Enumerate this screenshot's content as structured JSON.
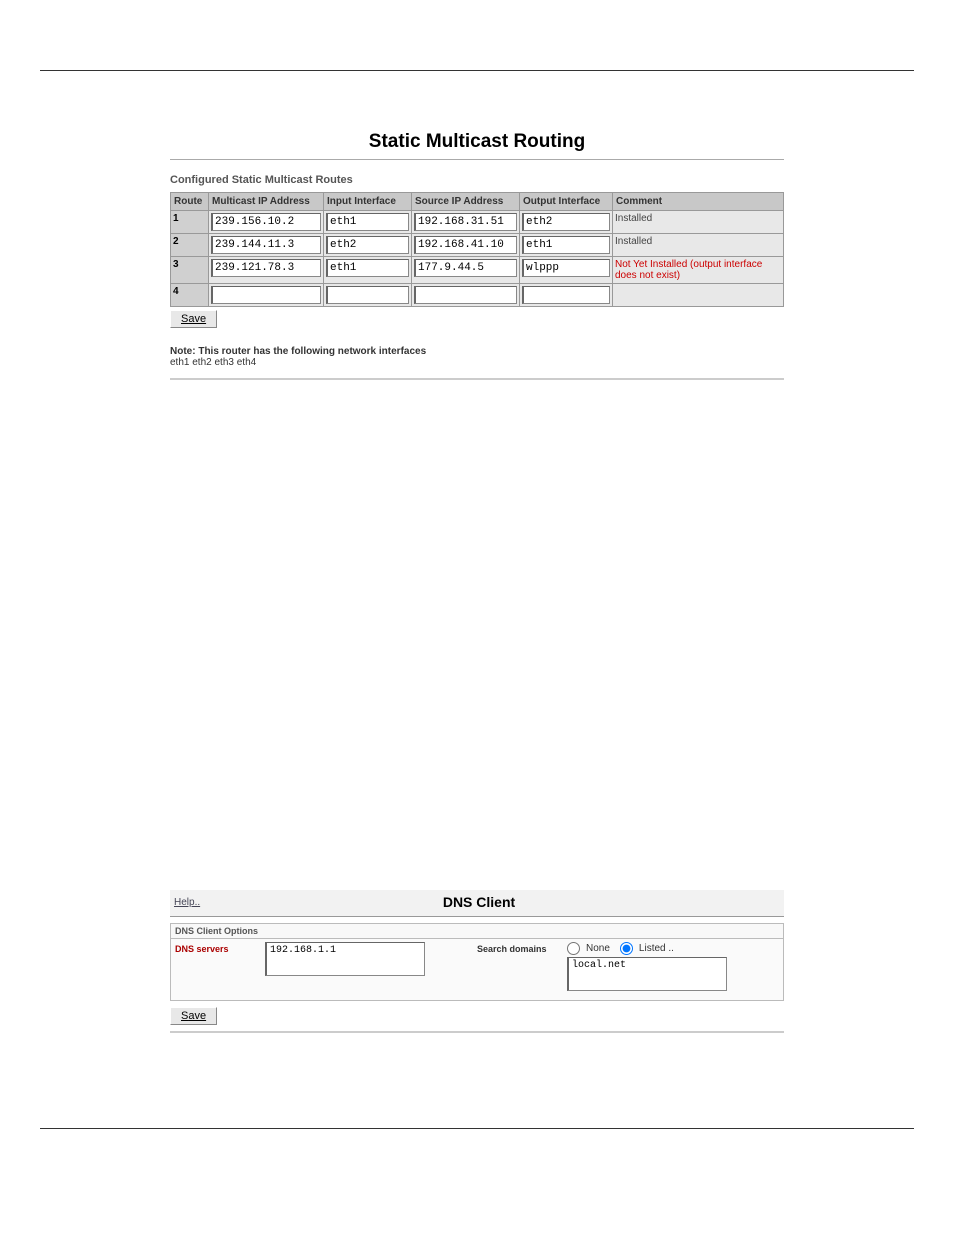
{
  "page1": {
    "title": "Static Multicast Routing",
    "section_label": "Configured Static Multicast Routes",
    "columns": {
      "route": "Route",
      "multicast_ip": "Multicast IP Address",
      "input_if": "Input Interface",
      "source_ip": "Source IP Address",
      "output_if": "Output Interface",
      "comment": "Comment"
    },
    "rows": [
      {
        "num": "1",
        "multicast_ip": "239.156.10.2",
        "input_if": "eth1",
        "source_ip": "192.168.31.51",
        "output_if": "eth2",
        "comment": "Installed",
        "error": false
      },
      {
        "num": "2",
        "multicast_ip": "239.144.11.3",
        "input_if": "eth2",
        "source_ip": "192.168.41.10",
        "output_if": "eth1",
        "comment": "Installed",
        "error": false
      },
      {
        "num": "3",
        "multicast_ip": "239.121.78.3",
        "input_if": "eth1",
        "source_ip": "177.9.44.5",
        "output_if": "wlppp",
        "comment": "Not Yet Installed (output interface does not exist)",
        "error": true
      },
      {
        "num": "4",
        "multicast_ip": "",
        "input_if": "",
        "source_ip": "",
        "output_if": "",
        "comment": "",
        "error": false
      }
    ],
    "save_label": "Save",
    "note_bold": "Note: This router has the following network interfaces",
    "note_line": "eth1 eth2 eth3 eth4"
  },
  "page2": {
    "help_label": "Help..",
    "title": "DNS Client",
    "options_header": "DNS Client Options",
    "dns_servers_label": "DNS servers",
    "dns_servers_value": "192.168.1.1",
    "search_domains_label": "Search domains",
    "radio_none": "None",
    "radio_listed": "Listed ..",
    "search_domains_value": "local.net",
    "save_label": "Save"
  }
}
